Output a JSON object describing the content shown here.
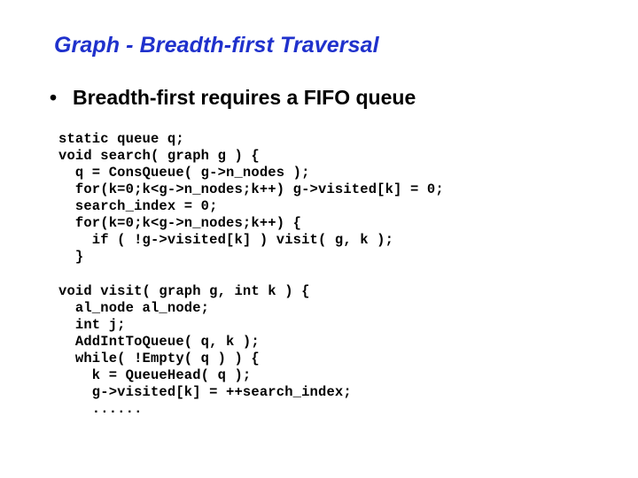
{
  "slide": {
    "title": "Graph - Breadth-first Traversal",
    "title_color": "#1f31cc",
    "background_color": "#ffffff",
    "body_text_color": "#000000"
  },
  "bullets": [
    {
      "marker": "•",
      "text": "Breadth-first requires a FIFO queue"
    }
  ],
  "code_blocks": [
    {
      "name": "search-function",
      "lines": [
        "static queue q;",
        "void search( graph g ) {",
        "  q = ConsQueue( g->n_nodes );",
        "  for(k=0;k<g->n_nodes;k++) g->visited[k] = 0;",
        "  search_index = 0;",
        "  for(k=0;k<g->n_nodes;k++) {",
        "    if ( !g->visited[k] ) visit( g, k );",
        "  }"
      ]
    },
    {
      "name": "visit-function",
      "lines": [
        "void visit( graph g, int k ) {",
        "  al_node al_node;",
        "  int j;",
        "  AddIntToQueue( q, k );",
        "  while( !Empty( q ) ) {",
        "    k = QueueHead( q );",
        "    g->visited[k] = ++search_index;",
        "    ......"
      ]
    }
  ]
}
